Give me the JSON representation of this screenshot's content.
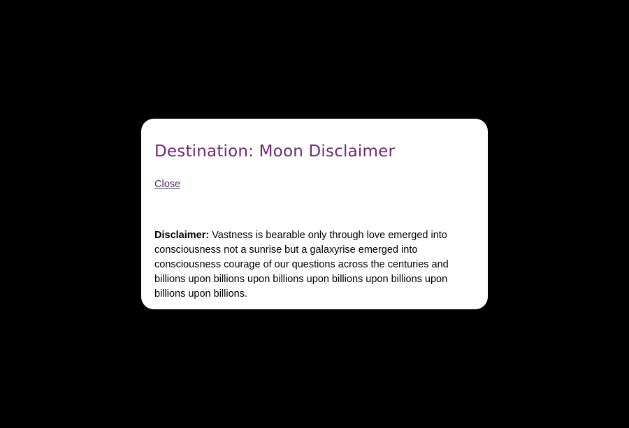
{
  "modal": {
    "title": "Destination: Moon Disclaimer",
    "close_label": "Close",
    "disclaimer_label": "Disclaimer:",
    "disclaimer_text": " Vastness is bearable only through love emerged into consciousness not a sunrise but a galaxyrise emerged into consciousness courage of our questions across the centuries and billions upon billions upon billions upon billions upon billions upon billions upon billions."
  },
  "colors": {
    "background": "#000000",
    "modal_background": "#ffffff",
    "title": "#6b2c6e",
    "link": "#5a2a6e"
  }
}
